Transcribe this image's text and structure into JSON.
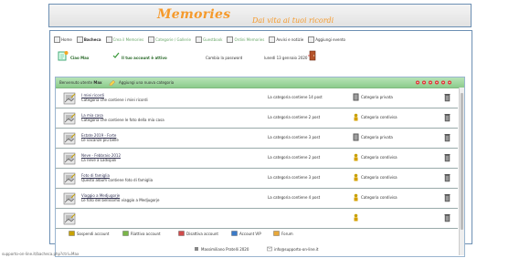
{
  "banner": {
    "title": "Memories",
    "subtitle": "Dai vita ai tuoi ricordi"
  },
  "nav": [
    {
      "label": "Home",
      "style": "dark"
    },
    {
      "label": "Bacheca",
      "style": "active"
    },
    {
      "label": "Crea il Memories",
      "style": "green"
    },
    {
      "label": "Categorie / Gallerie",
      "style": "green"
    },
    {
      "label": "Guestbook",
      "style": "green"
    },
    {
      "label": "Ordini Memories",
      "style": "green"
    },
    {
      "label": "Avvisi e notizie",
      "style": "dark"
    },
    {
      "label": "Aggiungi evento",
      "style": "dark"
    }
  ],
  "user": {
    "name": "Ciao Max",
    "account_status": "Il tuo account è attivo",
    "change_password": "Cambia la password",
    "date": "lunedì 13 gennaio 2020"
  },
  "list": {
    "welcome_prefix": "Benvenuto utente",
    "welcome_user": "Max",
    "add_category": "Aggiungi una nuova categoria",
    "rows": [
      {
        "name": "I miei ricordi",
        "desc": "Categoria che contiene i miei ricordi",
        "count": "La categoria contiene 14 post",
        "type": "Categoria privata",
        "type_kind": "private"
      },
      {
        "name": "La mia casa",
        "desc": "Categoria che contiene le foto della mia casa",
        "count": "La categoria contiene 2 post",
        "type": "Categoria condivisa",
        "type_kind": "shared"
      },
      {
        "name": "Estate 2019 - Forte",
        "desc": "Le vacanze più belle",
        "count": "La categoria contiene 3 post",
        "type": "Categoria privata",
        "type_kind": "private"
      },
      {
        "name": "Neve - Febbraio 2012",
        "desc": "La neve a Ladispoli",
        "count": "La categoria contiene 2 post",
        "type": "Categoria condivisa",
        "type_kind": "shared"
      },
      {
        "name": "Foto di famiglia",
        "desc": "Questo album contiene foto di famiglia",
        "count": "La categoria contiene 3 post",
        "type": "Categoria condivisa",
        "type_kind": "shared"
      },
      {
        "name": "Viaggio a Medjugorje",
        "desc": "Le foto del bellissimo viaggio a Medjugorje",
        "count": "La categoria contiene 4 post",
        "type": "Categoria condivisa",
        "type_kind": "shared"
      },
      {
        "name": "",
        "desc": "",
        "count": "",
        "type": "",
        "type_kind": "shared"
      }
    ]
  },
  "actions": [
    {
      "label": "Sospendi account"
    },
    {
      "label": "Riattiva account"
    },
    {
      "label": "Disattiva account"
    },
    {
      "label": "Account VIP"
    },
    {
      "label": "Forum"
    }
  ],
  "footer": {
    "copyright": "Massimiliano Pratelli 2020",
    "email": "info@supporto-on-line.it"
  },
  "status_url": "supporto-on-line.it/bacheca.php?ctrl=Max",
  "colors": {
    "accent_orange": "#f59a2c",
    "green_bar": "#8ccc8c",
    "border_blue": "#6c8fb3"
  }
}
